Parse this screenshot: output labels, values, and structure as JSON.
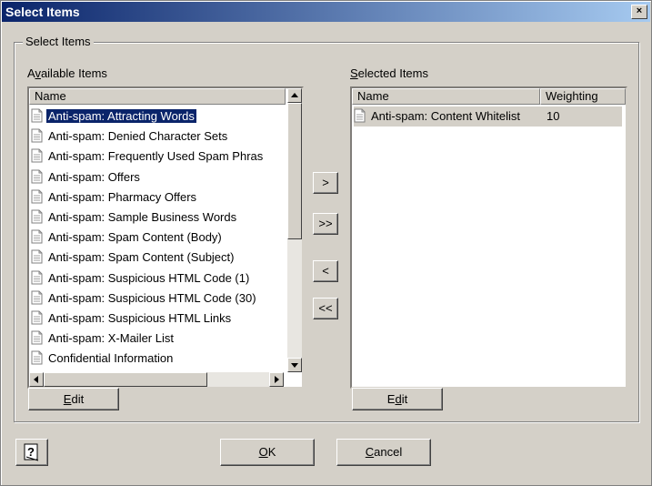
{
  "window": {
    "title": "Select Items",
    "close": "×"
  },
  "group": {
    "label": "Select Items"
  },
  "available": {
    "label_pre": "A",
    "label_u": "v",
    "label_post": "ailable Items",
    "column": "Name",
    "items": [
      "Anti-spam: Attracting Words",
      "Anti-spam: Denied Character Sets",
      "Anti-spam: Frequently Used Spam Phras",
      "Anti-spam: Offers",
      "Anti-spam: Pharmacy Offers",
      "Anti-spam: Sample Business Words",
      "Anti-spam: Spam Content (Body)",
      "Anti-spam: Spam Content (Subject)",
      "Anti-spam: Suspicious HTML Code (1)",
      "Anti-spam: Suspicious HTML Code (30)",
      "Anti-spam: Suspicious HTML Links",
      "Anti-spam: X-Mailer List",
      "Confidential Information"
    ],
    "selected_index": 0,
    "edit_u": "E",
    "edit_post": "dit"
  },
  "selected": {
    "label_u": "S",
    "label_post": "elected Items",
    "col_name": "Name",
    "col_weight": "Weighting",
    "rows": [
      {
        "name": "Anti-spam: Content Whitelist",
        "weight": "10"
      }
    ],
    "edit_pre": "E",
    "edit_u": "d",
    "edit_post": "it"
  },
  "transfer": {
    "add": ">",
    "add_all": ">>",
    "remove": "<",
    "remove_all": "<<"
  },
  "footer": {
    "ok_u": "O",
    "ok_post": "K",
    "cancel_u": "C",
    "cancel_post": "ancel"
  },
  "icons": {
    "help": "help-icon",
    "doc": "document-icon"
  }
}
